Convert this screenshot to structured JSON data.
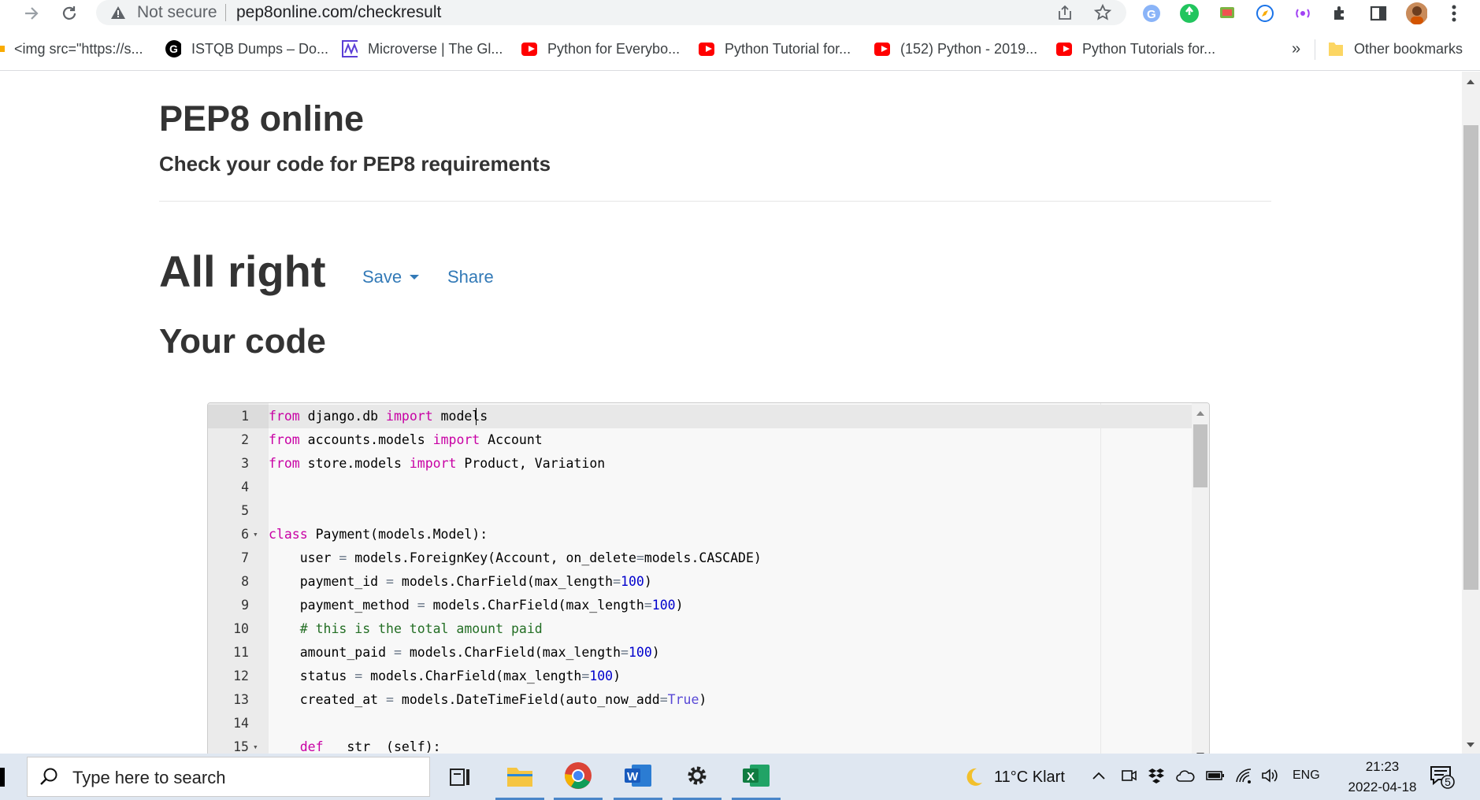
{
  "browser": {
    "security_label": "Not secure",
    "url": "pep8online.com/checkresult"
  },
  "bookmarks": [
    {
      "label": "<img src=\"https://s...",
      "icon": "generic"
    },
    {
      "label": "ISTQB Dumps – Do...",
      "icon": "g-circle"
    },
    {
      "label": "Microverse | The Gl...",
      "icon": "microverse"
    },
    {
      "label": "Python for Everybo...",
      "icon": "youtube"
    },
    {
      "label": "Python Tutorial for...",
      "icon": "youtube"
    },
    {
      "label": "(152) Python - 2019...",
      "icon": "youtube"
    },
    {
      "label": "Python Tutorials for...",
      "icon": "youtube"
    }
  ],
  "bookmarks_overflow": "»",
  "other_bookmarks": "Other bookmarks",
  "page": {
    "title": "PEP8 online",
    "subtitle": "Check your code for PEP8 requirements",
    "result": "All right",
    "save": "Save",
    "share": "Share",
    "code_heading": "Your code"
  },
  "code_lines": [
    {
      "n": "1",
      "fold": false,
      "tokens": [
        [
          "kw",
          "from"
        ],
        [
          "t",
          " django.db "
        ],
        [
          "kw",
          "import"
        ],
        [
          "t",
          " models"
        ]
      ]
    },
    {
      "n": "2",
      "fold": false,
      "tokens": [
        [
          "kw",
          "from"
        ],
        [
          "t",
          " accounts.models "
        ],
        [
          "kw",
          "import"
        ],
        [
          "t",
          " Account"
        ]
      ]
    },
    {
      "n": "3",
      "fold": false,
      "tokens": [
        [
          "kw",
          "from"
        ],
        [
          "t",
          " store.models "
        ],
        [
          "kw",
          "import"
        ],
        [
          "t",
          " Product, Variation"
        ]
      ]
    },
    {
      "n": "4",
      "fold": false,
      "tokens": []
    },
    {
      "n": "5",
      "fold": false,
      "tokens": []
    },
    {
      "n": "6",
      "fold": true,
      "tokens": [
        [
          "kw",
          "class"
        ],
        [
          "t",
          " Payment(models.Model):"
        ]
      ]
    },
    {
      "n": "7",
      "fold": false,
      "tokens": [
        [
          "t",
          "    user "
        ],
        [
          "op",
          "="
        ],
        [
          "t",
          " models.ForeignKey(Account, on_delete"
        ],
        [
          "op",
          "="
        ],
        [
          "t",
          "models.CASCADE)"
        ]
      ]
    },
    {
      "n": "8",
      "fold": false,
      "tokens": [
        [
          "t",
          "    payment_id "
        ],
        [
          "op",
          "="
        ],
        [
          "t",
          " models.CharField(max_length"
        ],
        [
          "op",
          "="
        ],
        [
          "num",
          "100"
        ],
        [
          "t",
          ")"
        ]
      ]
    },
    {
      "n": "9",
      "fold": false,
      "tokens": [
        [
          "t",
          "    payment_method "
        ],
        [
          "op",
          "="
        ],
        [
          "t",
          " models.CharField(max_length"
        ],
        [
          "op",
          "="
        ],
        [
          "num",
          "100"
        ],
        [
          "t",
          ")"
        ]
      ]
    },
    {
      "n": "10",
      "fold": false,
      "tokens": [
        [
          "cmt",
          "    # this is the total amount paid"
        ]
      ]
    },
    {
      "n": "11",
      "fold": false,
      "tokens": [
        [
          "t",
          "    amount_paid "
        ],
        [
          "op",
          "="
        ],
        [
          "t",
          " models.CharField(max_length"
        ],
        [
          "op",
          "="
        ],
        [
          "num",
          "100"
        ],
        [
          "t",
          ")"
        ]
      ]
    },
    {
      "n": "12",
      "fold": false,
      "tokens": [
        [
          "t",
          "    status "
        ],
        [
          "op",
          "="
        ],
        [
          "t",
          " models.CharField(max_length"
        ],
        [
          "op",
          "="
        ],
        [
          "num",
          "100"
        ],
        [
          "t",
          ")"
        ]
      ]
    },
    {
      "n": "13",
      "fold": false,
      "tokens": [
        [
          "t",
          "    created_at "
        ],
        [
          "op",
          "="
        ],
        [
          "t",
          " models.DateTimeField(auto_now_add"
        ],
        [
          "op",
          "="
        ],
        [
          "bool",
          "True"
        ],
        [
          "t",
          ")"
        ]
      ]
    },
    {
      "n": "14",
      "fold": false,
      "tokens": []
    },
    {
      "n": "15",
      "fold": true,
      "tokens": [
        [
          "t",
          "    "
        ],
        [
          "kw",
          "def"
        ],
        [
          "t",
          " __str__(self):"
        ]
      ]
    }
  ],
  "taskbar": {
    "search_placeholder": "Type here to search",
    "weather": "11°C  Klart",
    "language": "ENG",
    "time": "21:23",
    "date": "2022-04-18",
    "notifications": "5"
  }
}
